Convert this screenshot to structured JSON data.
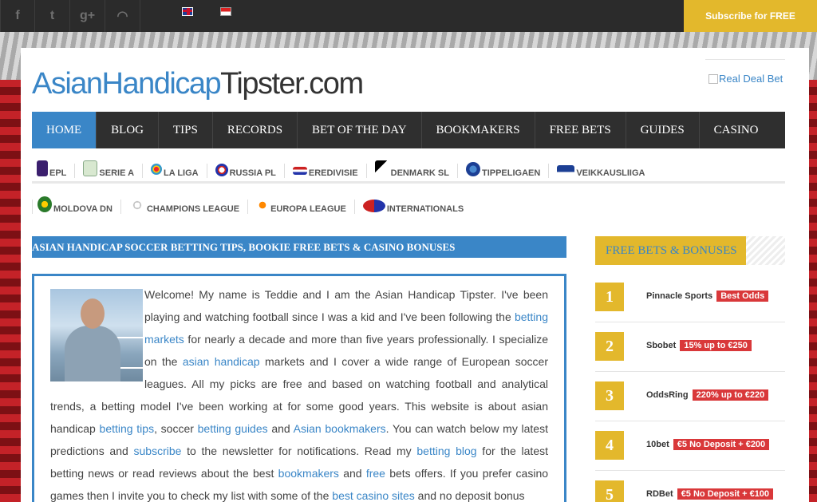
{
  "topbar": {
    "social": [
      {
        "icon": "facebook-icon",
        "glyph": "f"
      },
      {
        "icon": "twitter-icon",
        "glyph": "t"
      },
      {
        "icon": "google-plus-icon",
        "glyph": "g+"
      },
      {
        "icon": "rss-icon",
        "glyph": "◠"
      }
    ],
    "subscribe_label": "Subscribe for FREE"
  },
  "header": {
    "logo_part1": "AsianHandicap",
    "logo_part2": "Tipster",
    "logo_part3": ".com",
    "ad_alt": "Real Deal Bet"
  },
  "nav": [
    "HOME",
    "BLOG",
    "TIPS",
    "RECORDS",
    "BET OF THE DAY",
    "BOOKMAKERS",
    "FREE BETS",
    "GUIDES",
    "CASINO"
  ],
  "leagues_row1": [
    "EPL",
    "SERIE A",
    "LA LIGA",
    "RUSSIA PL",
    "EREDIVISIE",
    "DENMARK SL",
    "TIPPELIGAEN",
    "VEIKKAUSLIIGA"
  ],
  "leagues_row2": [
    "MOLDOVA DN",
    "CHAMPIONS LEAGUE",
    "EUROPA LEAGUE",
    "INTERNATIONALS"
  ],
  "colors": {
    "accent": "#3a86c7",
    "gold": "#e3b82c",
    "badge": "#d9383a",
    "nav": "#2f2f2f"
  },
  "content": {
    "heading": "ASIAN HANDICAP SOCCER BETTING TIPS, BOOKIE FREE BETS & CASINO BONUSES",
    "p1": "Welcome! My name is Teddie and I am the Asian Handicap Tipster. I've been playing and watching football since I was a kid and I've been following the ",
    "l1": "betting markets",
    "p2": " for nearly a decade and more than five years professionally. I specialize on the ",
    "l2": "asian handicap",
    "p3": " markets and I cover a wide range of European soccer leagues. All my picks are free and based on watching football and analytical trends, a betting model I've been working at for some good years. This website is about asian handicap ",
    "l3": "betting tips",
    "p4": ", soccer ",
    "l4": "betting guides",
    "p5": " and ",
    "l5": "Asian bookmakers",
    "p6": ". You can watch below my latest predictions and ",
    "l6": "subscribe",
    "p7": " to the newsletter for notifications. Read my ",
    "l7": "betting blog",
    "p8": " for the latest betting news or read reviews about the best ",
    "l8": "bookmakers",
    "p9": " and ",
    "l9": "free",
    "p10": " bets offers. If you prefer casino games then I invite you to check my list with some of the ",
    "l10": "best casino sites",
    "p11": " and no deposit bonus"
  },
  "sidebar": {
    "heading": "FREE BETS & BONUSES",
    "bonuses": [
      {
        "rank": "1",
        "name": "Pinnacle Sports",
        "offer": "Best Odds"
      },
      {
        "rank": "2",
        "name": "Sbobet",
        "offer": "15% up to €250"
      },
      {
        "rank": "3",
        "name": "OddsRing",
        "offer": "220% up to €220"
      },
      {
        "rank": "4",
        "name": "10bet",
        "offer": "€5 No Deposit + €200"
      },
      {
        "rank": "5",
        "name": "RDBet",
        "offer": "€5 No Deposit + €100"
      }
    ]
  }
}
